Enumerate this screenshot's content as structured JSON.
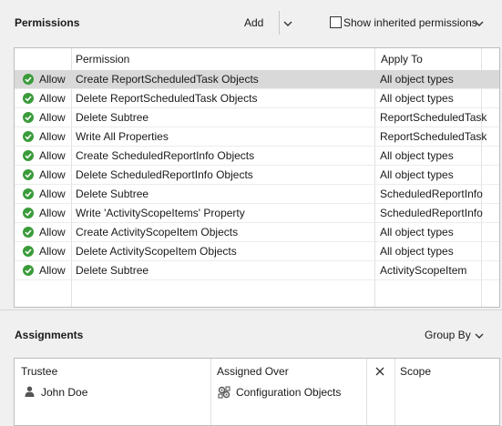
{
  "permissions": {
    "title": "Permissions",
    "add_label": "Add",
    "show_inherited_label": "Show inherited permissions",
    "show_inherited_checked": false,
    "columns": {
      "permission": "Permission",
      "apply_to": "Apply To"
    },
    "rows": [
      {
        "access": "Allow",
        "permission": "Create ReportScheduledTask Objects",
        "apply_to": "All object types",
        "selected": true
      },
      {
        "access": "Allow",
        "permission": "Delete ReportScheduledTask Objects",
        "apply_to": "All object types"
      },
      {
        "access": "Allow",
        "permission": "Delete Subtree",
        "apply_to": "ReportScheduledTask"
      },
      {
        "access": "Allow",
        "permission": "Write All Properties",
        "apply_to": "ReportScheduledTask"
      },
      {
        "access": "Allow",
        "permission": "Create ScheduledReportInfo Objects",
        "apply_to": "All object types"
      },
      {
        "access": "Allow",
        "permission": "Delete ScheduledReportInfo Objects",
        "apply_to": "All object types"
      },
      {
        "access": "Allow",
        "permission": "Delete Subtree",
        "apply_to": "ScheduledReportInfo"
      },
      {
        "access": "Allow",
        "permission": "Write 'ActivityScopeItems' Property",
        "apply_to": "ScheduledReportInfo"
      },
      {
        "access": "Allow",
        "permission": "Create ActivityScopeItem Objects",
        "apply_to": "All object types"
      },
      {
        "access": "Allow",
        "permission": "Delete ActivityScopeItem Objects",
        "apply_to": "All object types"
      },
      {
        "access": "Allow",
        "permission": "Delete Subtree",
        "apply_to": "ActivityScopeItem"
      }
    ],
    "allow_icon": "green-check-circle-icon",
    "allow_color": "#3a9b3a"
  },
  "assignments": {
    "title": "Assignments",
    "group_by_label": "Group By",
    "columns": {
      "trustee": "Trustee",
      "assigned_over": "Assigned Over",
      "scope": "Scope"
    },
    "clear_icon": "close-icon",
    "trustee": {
      "name": "John Doe",
      "icon": "user-icon"
    },
    "assigned_over": {
      "name": "Configuration Objects",
      "icon": "configuration-objects-icon"
    }
  }
}
